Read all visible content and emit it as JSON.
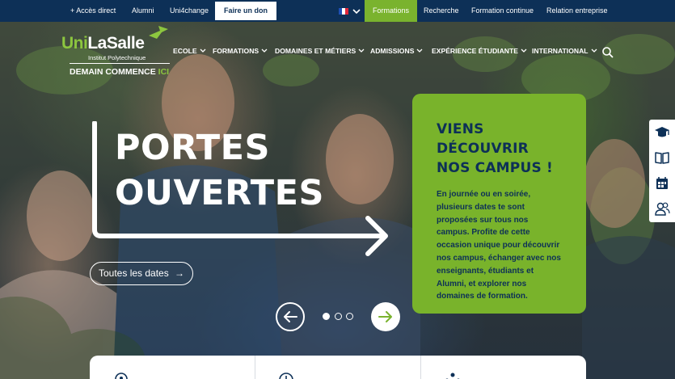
{
  "topbar": {
    "acces_direct": "+ Accès direct",
    "alumni": "Alumni",
    "uni4change": "Uni4change",
    "don": "Faire un don",
    "language": "FR",
    "formations": "Formations",
    "recherche": "Recherche",
    "formation_continue": "Formation continue",
    "relation_entreprise": "Relation entreprise"
  },
  "logo": {
    "brand_uni": "Uni",
    "brand_rest": "LaSalle",
    "subtitle": "Institut Polytechnique",
    "tagline_main": "DEMAIN COMMENCE ",
    "tagline_ici": "ICI"
  },
  "nav": {
    "items": [
      "ECOLE",
      "FORMATIONS",
      "DOMAINES ET MÉTIERS",
      "ADMISSIONS",
      "EXPÉRIENCE ÉTUDIANTE",
      "INTERNATIONAL"
    ]
  },
  "hero": {
    "title_line1": "PORTES",
    "title_line2": "OUVERTES",
    "button": "Toutes les dates",
    "button_arrow": "→"
  },
  "card": {
    "title_line1": "VIENS DÉCOUVRIR",
    "title_line2": "NOS CAMPUS !",
    "body": "En journée ou en soirée, plusieurs dates te sont proposées sur tous nos campus. Profite de cette occasion unique pour découvrir nos campus, échanger avec nos enseignants, étudiants et Alumni, et explorer nos domaines de formation."
  },
  "carousel": {
    "slides": 3,
    "active": 1
  },
  "sidebar": {
    "icons": [
      "graduation-cap-icon",
      "book-icon",
      "calendar-icon",
      "people-icon"
    ]
  },
  "colors": {
    "navy": "#0d3057",
    "green": "#7ab32e",
    "white": "#ffffff"
  }
}
